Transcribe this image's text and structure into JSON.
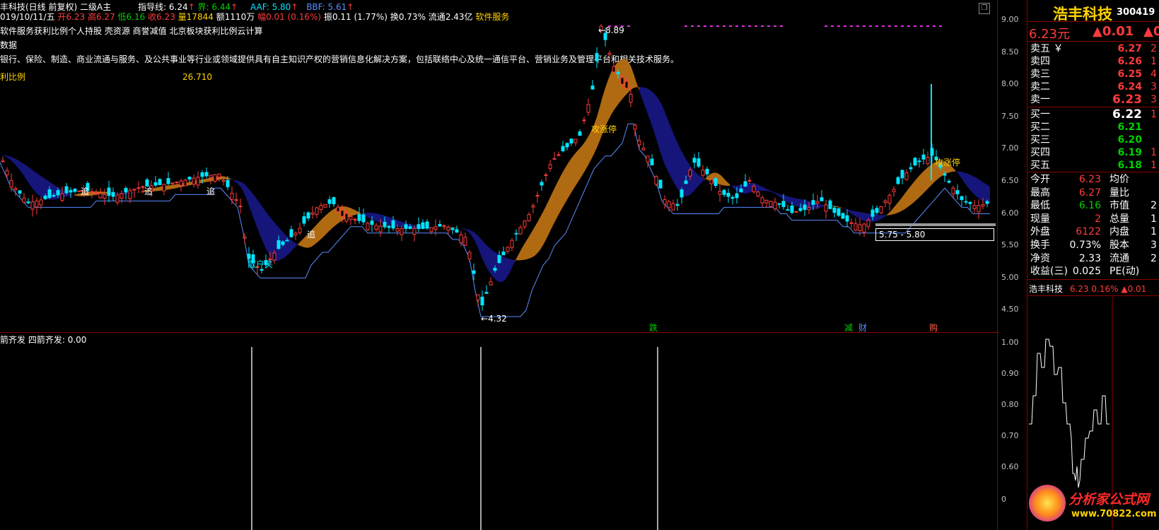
{
  "header": {
    "stock_title": "丰科技(日线 前复权)",
    "chart_mode": "二级A主",
    "date": "019/10/11/五",
    "open_label": "开",
    "open_value": "6.23",
    "high_label": "高",
    "high_value": "6.27",
    "low_label": "低",
    "low_value": "6.16",
    "close_label": "收",
    "close_value": "6.23",
    "vol_label": "量",
    "vol_value": "17844",
    "amount_label": "额",
    "amount_value": "1110万",
    "change_label": "幅",
    "change_value": "0.01 (0.16%)",
    "amp_label": "振",
    "amp_value": "0.11 (1.77%)",
    "turnover_label": "换",
    "turnover_value": "0.73%",
    "float_label": "流通",
    "float_value": "2.43亿",
    "sector": "软件服务",
    "ind_guide": "指导线: 6.24",
    "ind_jie": "界: 6.44",
    "ind_aaf": "AAF: 5.80",
    "ind_bbf": "BBF: 5.61",
    "concepts": "软件服务获利比例个人持股 壳资源 商誉减值 北京板块获利比例云计算",
    "data_label": "数据",
    "description": "银行、保险、制造、商业流通与服务、及公共事业等行业或领域提供具有自主知识产权的营销信息化解决方案，包括联络中心及统一通信平台、营销业务及管理平台和相关技术服务。",
    "profit_label": "利比例",
    "profit_value": "26.710"
  },
  "annotations": {
    "peak": "8.89",
    "low": "4.32",
    "range": "5.75 - 5.80",
    "chase": "追",
    "limit_up": "攻涨停",
    "sanhu": "散户笑",
    "signal_fall": "跌",
    "signal_reduce": "减",
    "signal_cai": "财",
    "signal_gou": "购"
  },
  "lower_panel": {
    "title": "箭齐发",
    "value_text": "四箭齐发: 0.00"
  },
  "price_axis": [
    "9.00",
    "8.50",
    "8.00",
    "7.50",
    "7.00",
    "6.50",
    "6.00",
    "5.50",
    "5.00",
    "4.50"
  ],
  "lower_axis": [
    "1.00",
    "0.90",
    "0.80",
    "0.70",
    "0.60",
    "0"
  ],
  "sidebar": {
    "name": "浩丰科技",
    "code": "300419",
    "price": "6.23元",
    "change": "▲0.01",
    "pct": "▲0",
    "sell": [
      {
        "label": "卖五",
        "mark": "￥",
        "price": "6.27",
        "vol": "2"
      },
      {
        "label": "卖四",
        "mark": "",
        "price": "6.26",
        "vol": "1"
      },
      {
        "label": "卖三",
        "mark": "",
        "price": "6.25",
        "vol": "4"
      },
      {
        "label": "卖二",
        "mark": "",
        "price": "6.24",
        "vol": "3"
      },
      {
        "label": "卖一",
        "mark": "",
        "price": "6.23",
        "vol": "3"
      }
    ],
    "buy": [
      {
        "label": "买一",
        "price": "6.22",
        "vol": "1"
      },
      {
        "label": "买二",
        "price": "6.21",
        "vol": ""
      },
      {
        "label": "买三",
        "price": "6.20",
        "vol": ""
      },
      {
        "label": "买四",
        "price": "6.19",
        "vol": "1"
      },
      {
        "label": "买五",
        "price": "6.18",
        "vol": "1"
      }
    ],
    "stats": [
      {
        "l1": "今开",
        "v1": "6.23",
        "l2": "均价",
        "v2": ""
      },
      {
        "l1": "最高",
        "v1": "6.27",
        "l2": "量比",
        "v2": ""
      },
      {
        "l1": "最低",
        "v1": "6.16",
        "l2": "市值",
        "v2": "2"
      },
      {
        "l1": "现量",
        "v1": "2",
        "l2": "总量",
        "v2": "1"
      },
      {
        "l1": "外盘",
        "v1": "6122",
        "l2": "内盘",
        "v2": "1"
      },
      {
        "l1": "换手",
        "v1": "0.73%",
        "l2": "股本",
        "v2": "3"
      },
      {
        "l1": "净资",
        "v1": "2.33",
        "l2": "流通",
        "v2": "2"
      },
      {
        "l1": "收益(三)",
        "v1": "0.025",
        "l2": "PE(动)",
        "v2": ""
      }
    ],
    "mini_title": "浩丰科技",
    "mini_price": "6.23",
    "mini_pct": "0.16%",
    "mini_change": "▲0.01",
    "mini_axis": [
      "6",
      "6",
      "6",
      "6",
      "6",
      "6",
      "6",
      "6",
      "6",
      "6",
      "6",
      "6"
    ]
  },
  "watermark": {
    "brand": "分析家公式网",
    "url": "www.70822.com"
  },
  "colors": {
    "up": "#ff3b3b",
    "down": "#00e5ff",
    "ribbon_up": "#b06a12",
    "ribbon_down": "#15157a",
    "support": "#5a8cff"
  }
}
